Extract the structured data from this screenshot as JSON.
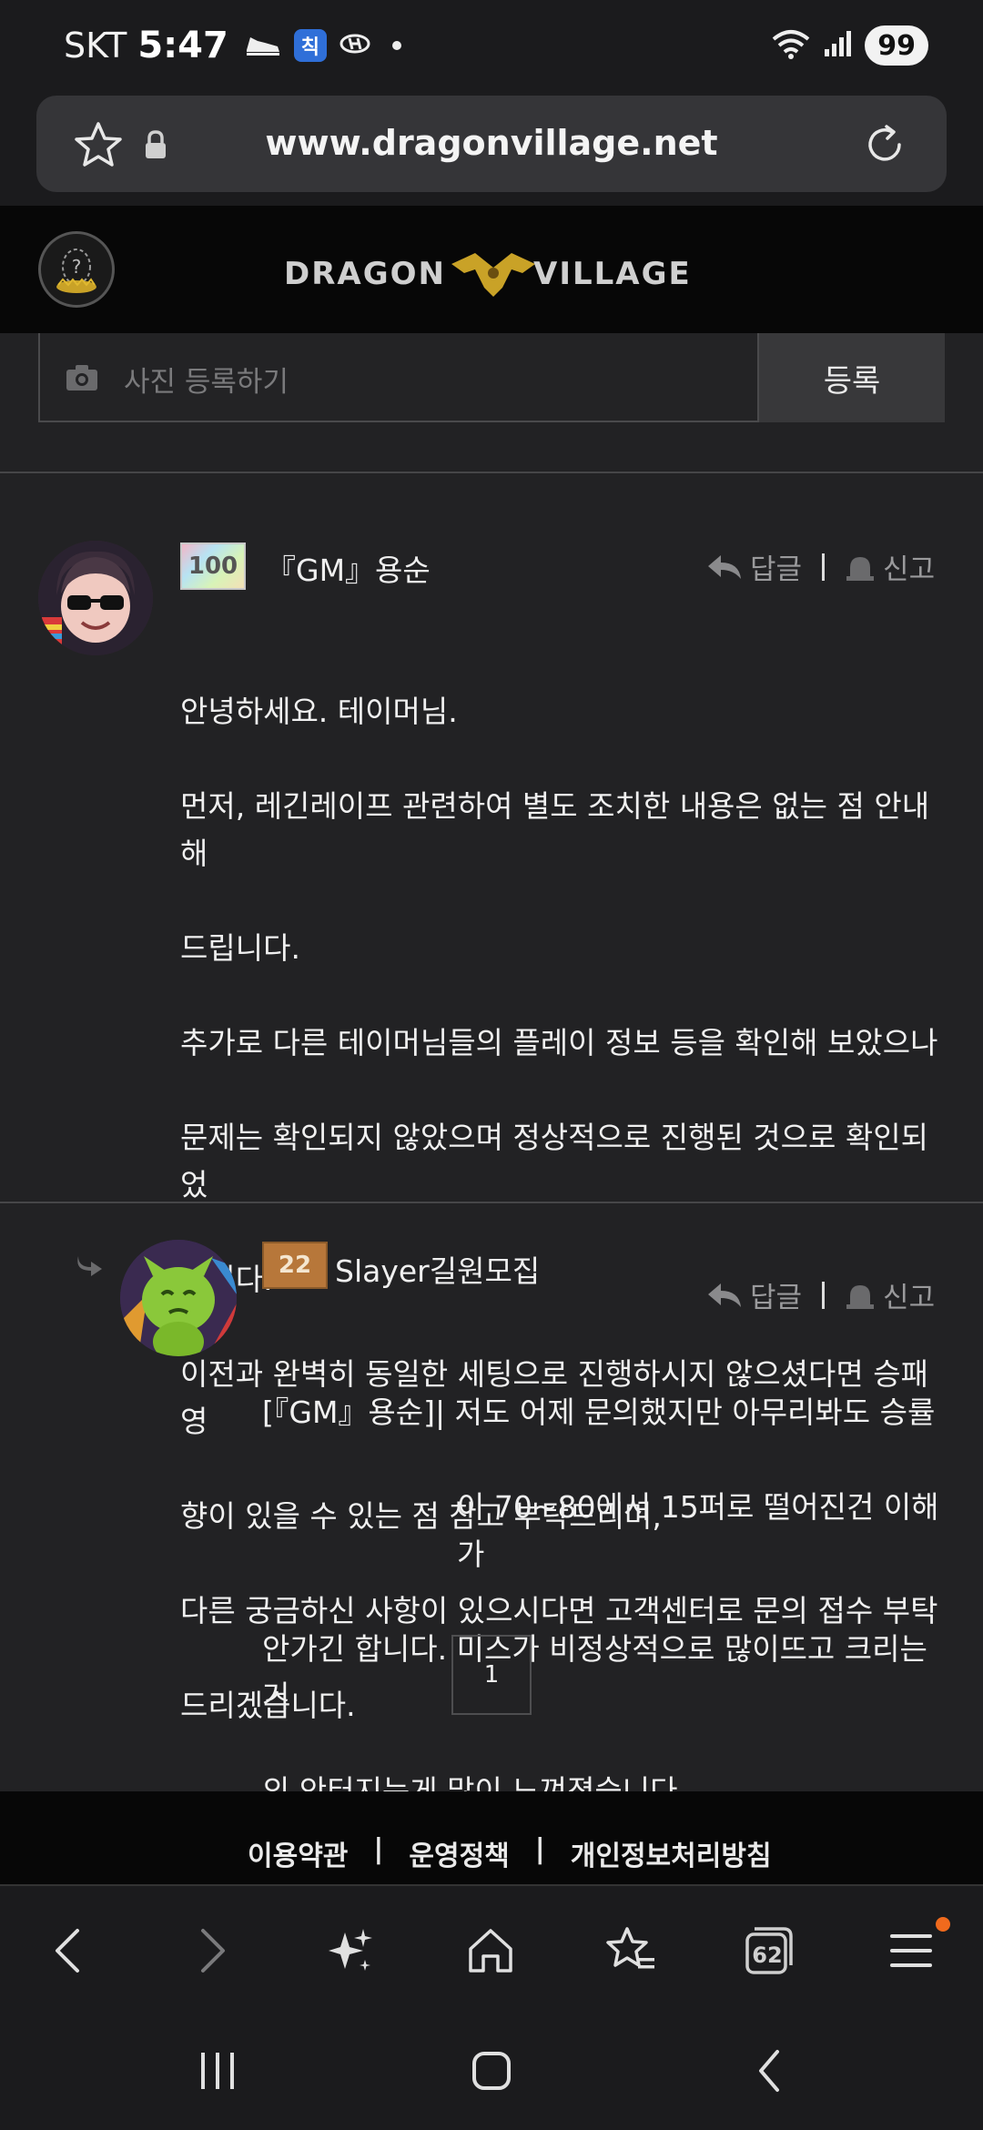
{
  "status_bar": {
    "carrier": "SKT",
    "time": "5:47",
    "app_badge": "칙",
    "battery": "99"
  },
  "url_bar": {
    "url": "www.dragonvillage.net"
  },
  "site_header": {
    "logo_text_left": "DRAGON",
    "logo_text_right": "VILLAGE"
  },
  "photo_upload": {
    "placeholder": "사진 등록하기",
    "submit_label": "등록"
  },
  "comments": [
    {
      "level": "100",
      "author": "『GM』용순",
      "reply_label": "답글",
      "report_label": "신고",
      "lines": [
        "안녕하세요. 테이머님.",
        "먼저, 레긴레이프 관련하여 별도 조치한 내용은 없는 점 안내해",
        "드립니다.",
        "추가로 다른 테이머님들의 플레이 정보 등을 확인해 보았으나",
        "문제는 확인되지 않았으며 정상적으로 진행된 것으로 확인되었",
        "습니다.",
        "이전과 완벽히 동일한 세팅으로 진행하시지 않으셨다면 승패 영",
        "향이 있을 수 있는 점 참고 부탁드리며,",
        "다른 궁금하신 사항이 있으시다면 고객센터로 문의 접수 부탁",
        "드리겠습니다."
      ]
    },
    {
      "level": "22",
      "author": "Slayer길원모집",
      "reply_label": "답글",
      "report_label": "신고",
      "mention": "[『GM』용순]",
      "lines": [
        "| 저도 어제 문의했지만 아무리봐도 승률",
        "이 70~80에서 15퍼로 떨어진건 이해가",
        "안가긴 합니다. 미스가 비정상적으로 많이뜨고 크리는 거",
        "의 안터지는게 많이 느껴졌습니다."
      ]
    }
  ],
  "pagination": {
    "current_page": "1"
  },
  "footer": {
    "links": [
      "이용약관",
      "|",
      "운영정책",
      "|",
      "개인정보처리방침"
    ]
  },
  "browser_toolbar": {
    "tab_count": "62"
  },
  "colors": {
    "background": "#222224",
    "notification": "#f06a1d",
    "logo_gold": "#c9a227"
  }
}
